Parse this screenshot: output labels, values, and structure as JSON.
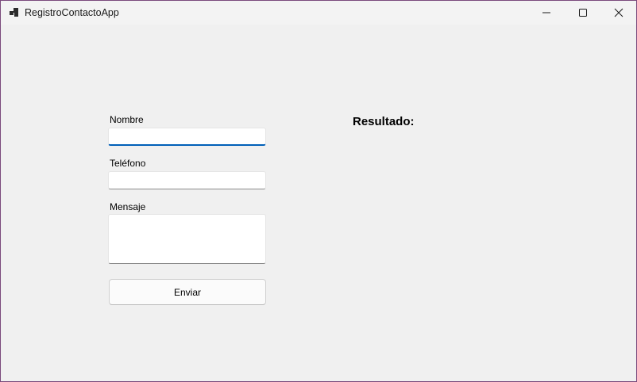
{
  "window": {
    "title": "RegistroContactoApp",
    "accent_color": "#005fb8"
  },
  "form": {
    "nombre_label": "Nombre",
    "nombre_value": "",
    "telefono_label": "Teléfono",
    "telefono_value": "",
    "mensaje_label": "Mensaje",
    "mensaje_value": "",
    "submit_label": "Enviar"
  },
  "result": {
    "label": "Resultado:",
    "value": ""
  },
  "icons": {
    "app": "app-icon",
    "minimize": "minimize-icon",
    "maximize": "maximize-icon",
    "close": "close-icon"
  }
}
